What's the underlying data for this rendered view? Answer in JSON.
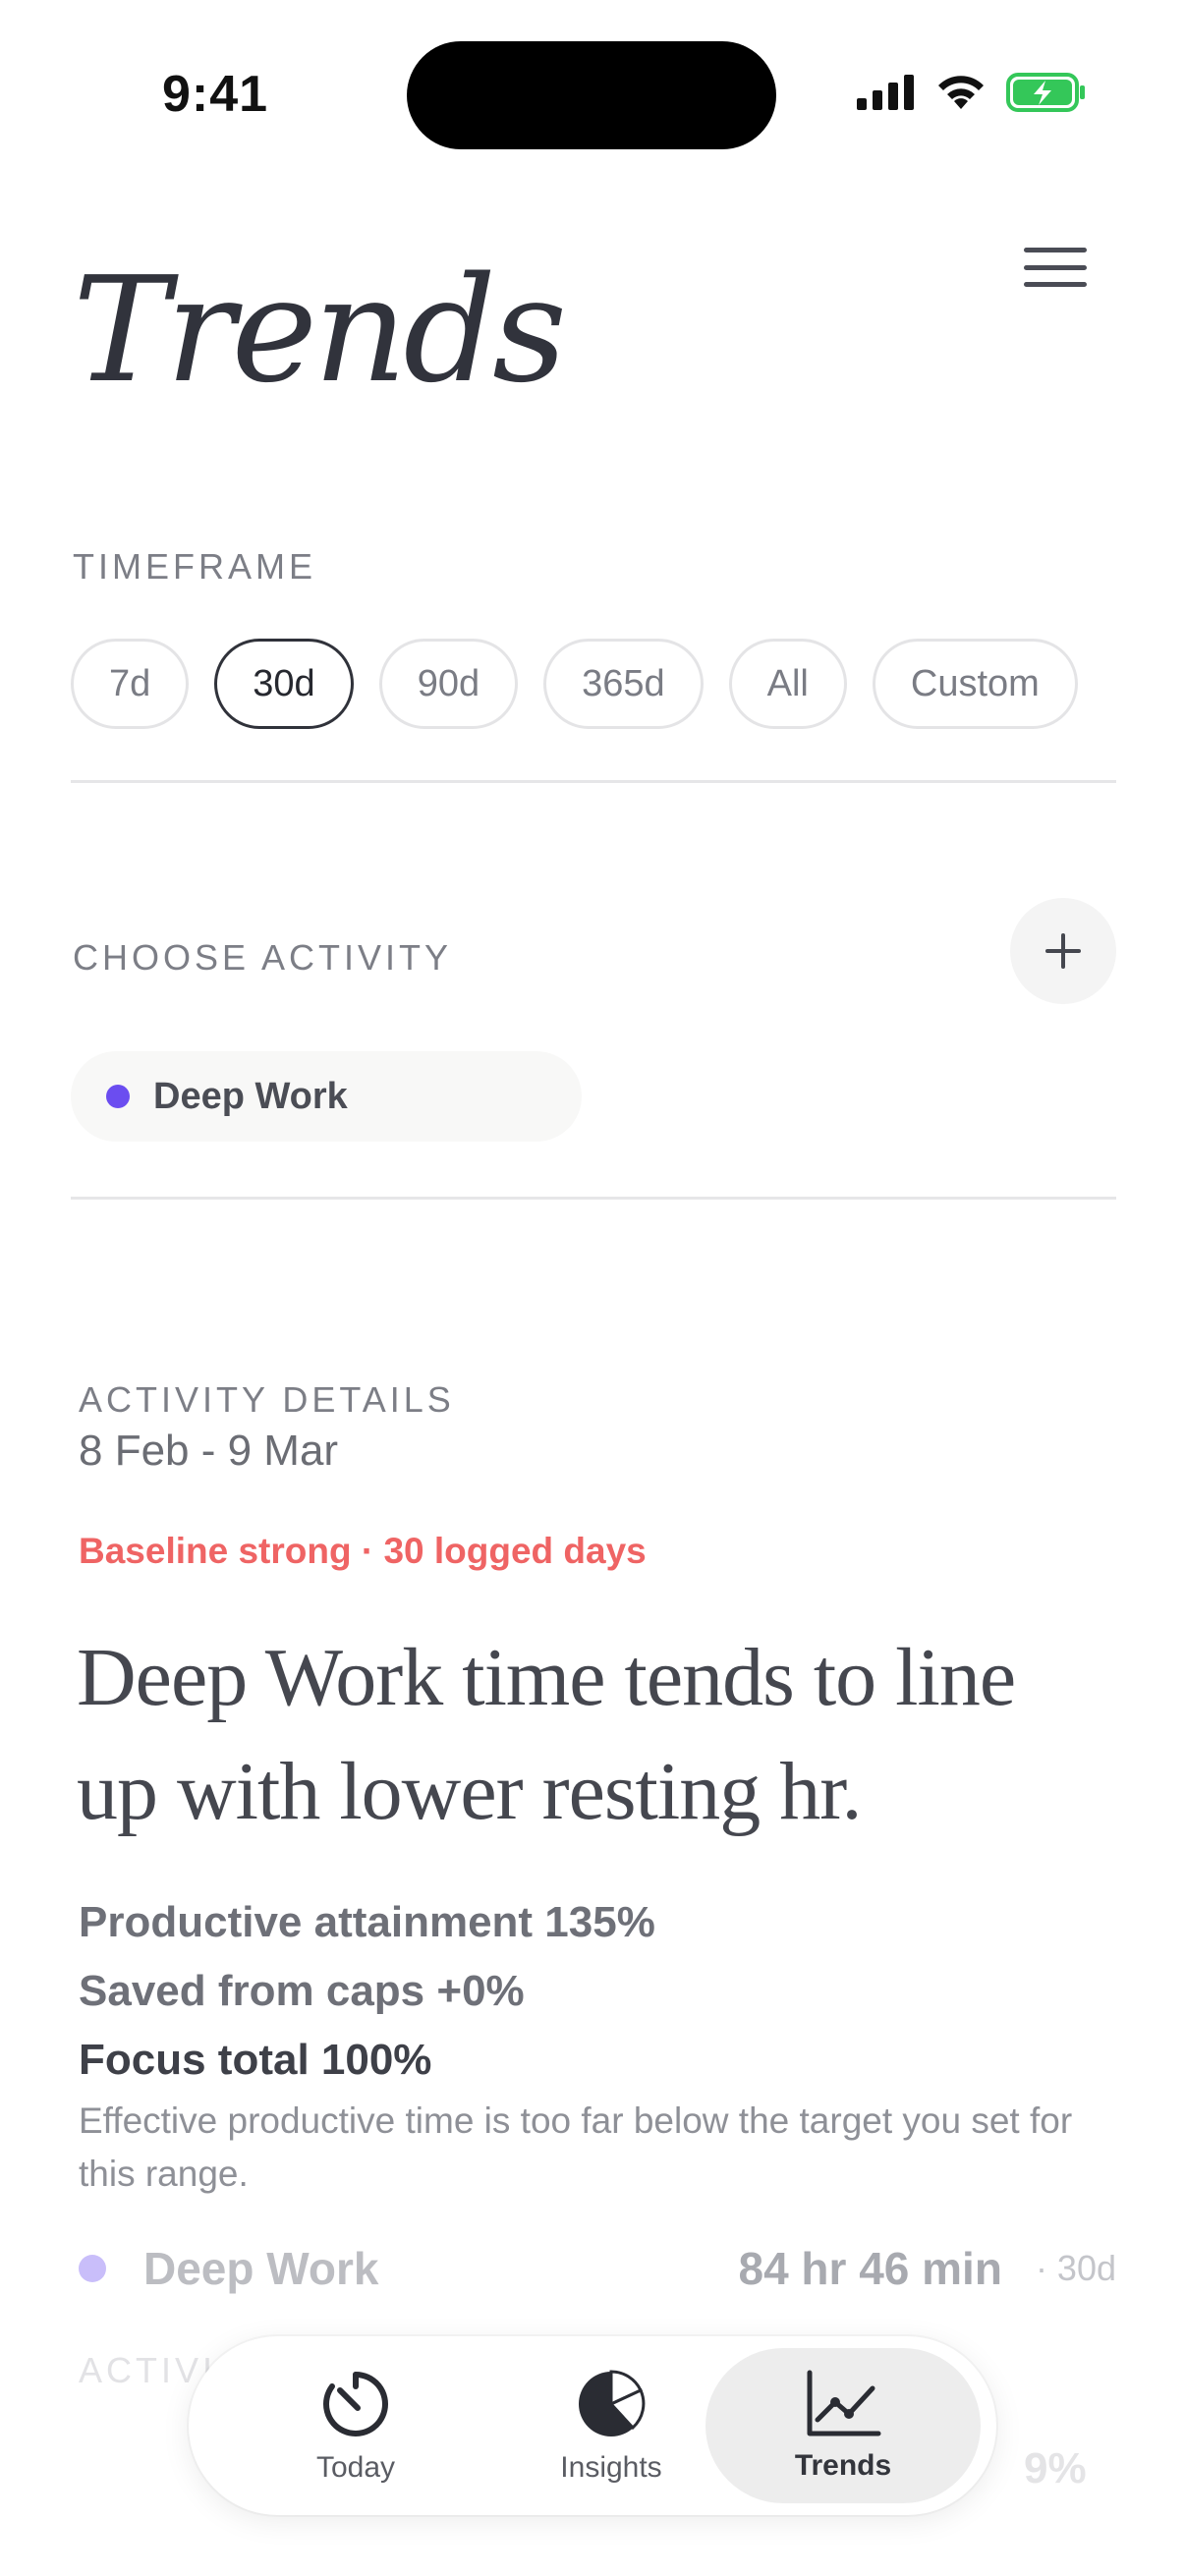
{
  "status_bar": {
    "time": "9:41"
  },
  "header": {
    "title": "Trends",
    "menu_icon": "hamburger-icon"
  },
  "timeframe": {
    "label": "TIMEFRAME",
    "options": [
      "7d",
      "30d",
      "90d",
      "365d",
      "All",
      "Custom"
    ],
    "selected": "30d"
  },
  "activity": {
    "label": "CHOOSE ACTIVITY",
    "chip": {
      "label": "Deep Work",
      "color": "#6b4df0"
    }
  },
  "details": {
    "label": "ACTIVITY DETAILS",
    "range": "8 Feb - 9 Mar",
    "badge": "Baseline strong · 30 logged days",
    "headline": "Deep Work time tends to line up with lower resting hr.",
    "stats": [
      "Productive attainment 135%",
      "Saved from caps +0%",
      "Focus total 100%"
    ],
    "note": "Effective productive time is too far below the target you set for this range.",
    "row": {
      "name": "Deep Work",
      "value": "84 hr 46 min",
      "range": "· 30d"
    },
    "faded_label": "ACTIVI",
    "faded_pct": "9%"
  },
  "nav": {
    "items": [
      {
        "label": "Today",
        "icon": "timer-icon"
      },
      {
        "label": "Insights",
        "icon": "pie-chart-icon"
      },
      {
        "label": "Trends",
        "icon": "line-chart-icon"
      }
    ],
    "active": "Trends"
  },
  "colors": {
    "accent": "#6b4df0",
    "badge": "#ef6464",
    "battery": "#34c759"
  }
}
